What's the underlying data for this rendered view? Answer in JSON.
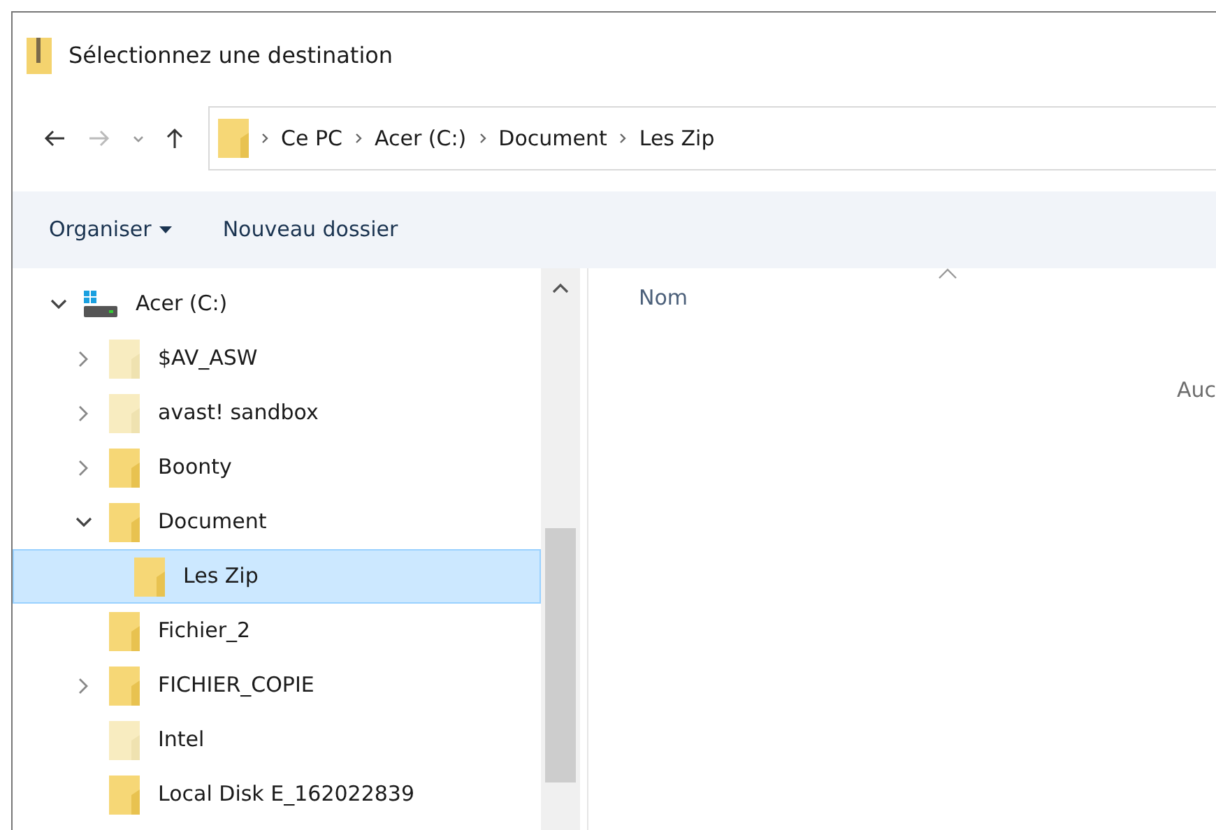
{
  "window": {
    "title": "Sélectionnez une destination"
  },
  "address_bar": {
    "breadcrumbs": [
      "Ce PC",
      "Acer (C:)",
      "Document",
      "Les Zip"
    ]
  },
  "toolbar": {
    "buttons": [
      {
        "label": "Organiser",
        "kind": "dropdown"
      },
      {
        "label": "Nouveau dossier",
        "kind": "plain"
      }
    ]
  },
  "tree": [
    {
      "label": "Acer (C:)",
      "kind": "drive",
      "expanded": true,
      "selected": false,
      "children": [
        {
          "label": "$AV_ASW",
          "kind": "folder",
          "expanded": false,
          "hidden": true,
          "selected": false
        },
        {
          "label": "avast! sandbox",
          "kind": "folder",
          "expanded": false,
          "hidden": true,
          "selected": false
        },
        {
          "label": "Boonty",
          "kind": "folder",
          "expanded": false,
          "hidden": false,
          "selected": false
        },
        {
          "label": "Document",
          "kind": "folder",
          "expanded": true,
          "hidden": false,
          "selected": false,
          "children": [
            {
              "label": "Les Zip",
              "kind": "folder",
              "hidden": false,
              "selected": true
            }
          ]
        },
        {
          "label": "Fichier_2",
          "kind": "folder",
          "hidden": false,
          "selected": false
        },
        {
          "label": "FICHIER_COPIE",
          "kind": "folder",
          "expanded": false,
          "hidden": false,
          "selected": false
        },
        {
          "label": "Intel",
          "kind": "folder",
          "hidden": true,
          "selected": false
        },
        {
          "label": "Local Disk E_162022839",
          "kind": "folder",
          "hidden": false,
          "selected": false
        }
      ]
    }
  ],
  "file_list": {
    "columns": [
      "Nom"
    ],
    "empty_message": "Auc"
  }
}
